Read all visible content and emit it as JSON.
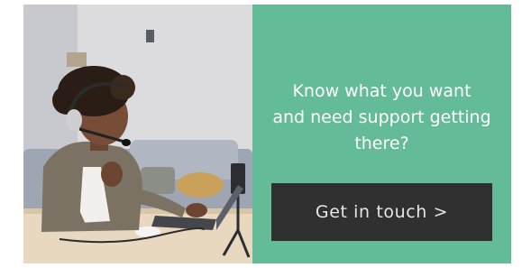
{
  "banner": {
    "headline_lines": [
      "Know what you want",
      "and need support getting",
      "there?"
    ],
    "cta_label": "Get in touch >",
    "colors": {
      "panel": "#63bb98",
      "button": "#2f302f",
      "text": "#ffffff"
    }
  }
}
